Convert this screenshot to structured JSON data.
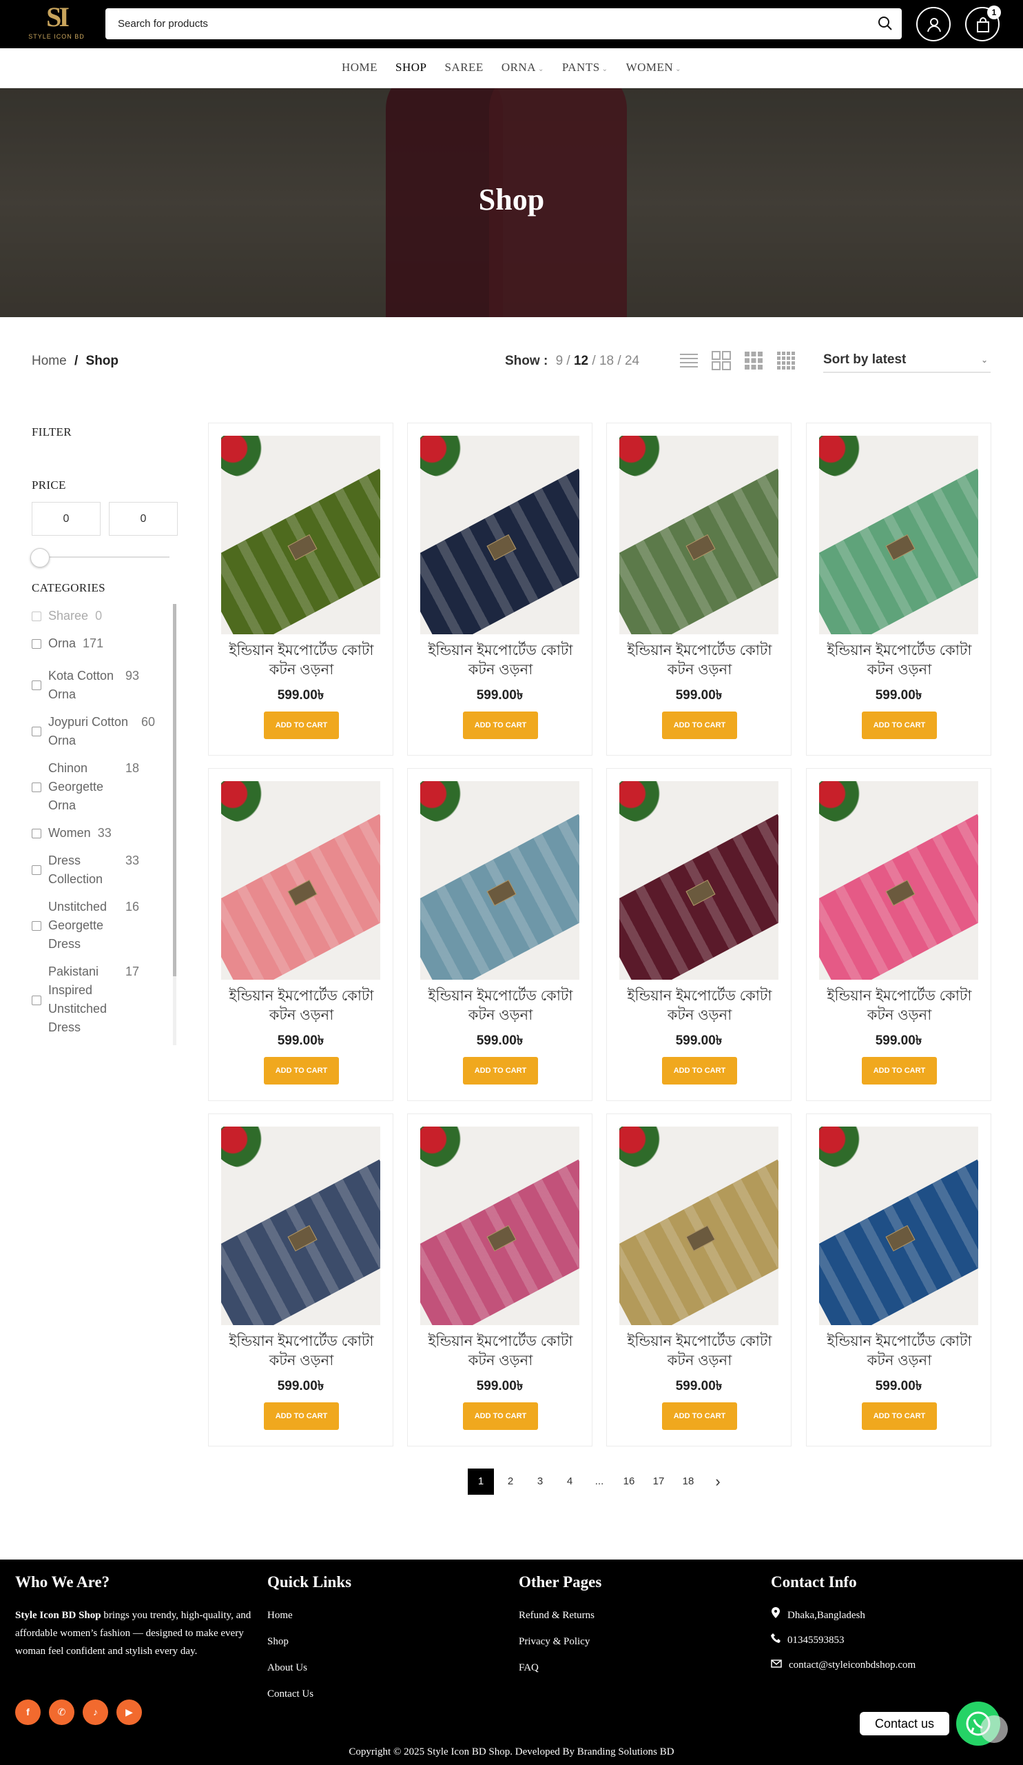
{
  "brand": {
    "mark": "SI",
    "name": "STYLE ICON BD"
  },
  "search": {
    "placeholder": "Search for products"
  },
  "cart": {
    "count": "1"
  },
  "nav": {
    "items": [
      "HOME",
      "SHOP",
      "SAREE",
      "ORNA",
      "PANTS",
      "WOMEN"
    ]
  },
  "hero": {
    "title": "Shop"
  },
  "breadcrumb": {
    "home": "Home",
    "sep": "/",
    "current": "Shop"
  },
  "show": {
    "label": "Show :",
    "options": [
      "9",
      "12",
      "18",
      "24"
    ],
    "selected": "12"
  },
  "sort": {
    "value": "Sort by latest"
  },
  "sidebar": {
    "filter_title": "FILTER",
    "price_title": "PRICE",
    "price_min": "0",
    "price_max": "0",
    "categories_title": "CATEGORIES",
    "categories": [
      {
        "name": "Sharee",
        "count": "0"
      },
      {
        "name": "Orna",
        "count": "171"
      },
      {
        "name": "Kota Cotton Orna",
        "count": "93"
      },
      {
        "name": "Joypuri Cotton Orna",
        "count": "60"
      },
      {
        "name": "Chinon Georgette Orna",
        "count": "18"
      },
      {
        "name": "Women",
        "count": "33"
      },
      {
        "name": "Dress Collection",
        "count": "33"
      },
      {
        "name": "Unstitched Georgette Dress",
        "count": "16"
      },
      {
        "name": "Pakistani Inspired Unstitched Dress",
        "count": "17"
      }
    ]
  },
  "products": [
    {
      "title": "ইন্ডিয়ান ইমপোর্টেড কোটা কটন ওড়না",
      "price": "599.00৳",
      "button": "ADD TO CART",
      "color": "#4e6a1e"
    },
    {
      "title": "ইন্ডিয়ান ইমপোর্টেড কোটা কটন ওড়না",
      "price": "599.00৳",
      "button": "ADD TO CART",
      "color": "#1d2740"
    },
    {
      "title": "ইন্ডিয়ান ইমপোর্টেড কোটা কটন ওড়না",
      "price": "599.00৳",
      "button": "ADD TO CART",
      "color": "#5c7a4a"
    },
    {
      "title": "ইন্ডিয়ান ইমপোর্টেড কোটা কটন ওড়না",
      "price": "599.00৳",
      "button": "ADD TO CART",
      "color": "#5fa37a"
    },
    {
      "title": "ইন্ডিয়ান ইমপোর্টেড কোটা কটন ওড়না",
      "price": "599.00৳",
      "button": "ADD TO CART",
      "color": "#e88a8e"
    },
    {
      "title": "ইন্ডিয়ান ইমপোর্টেড কোটা কটন ওড়না",
      "price": "599.00৳",
      "button": "ADD TO CART",
      "color": "#6e97a8"
    },
    {
      "title": "ইন্ডিয়ান ইমপোর্টেড কোটা কটন ওড়না",
      "price": "599.00৳",
      "button": "ADD TO CART",
      "color": "#5a1a2a"
    },
    {
      "title": "ইন্ডিয়ান ইমপোর্টেড কোটা কটন ওড়না",
      "price": "599.00৳",
      "button": "ADD TO CART",
      "color": "#e55a86"
    },
    {
      "title": "ইন্ডিয়ান ইমপোর্টেড কোটা কটন ওড়না",
      "price": "599.00৳",
      "button": "ADD TO CART",
      "color": "#3c4c6a"
    },
    {
      "title": "ইন্ডিয়ান ইমপোর্টেড কোটা কটন ওড়না",
      "price": "599.00৳",
      "button": "ADD TO CART",
      "color": "#c2527a"
    },
    {
      "title": "ইন্ডিয়ান ইমপোর্টেড কোটা কটন ওড়না",
      "price": "599.00৳",
      "button": "ADD TO CART",
      "color": "#b39a5a"
    },
    {
      "title": "ইন্ডিয়ান ইমপোর্টেড কোটা কটন ওড়না",
      "price": "599.00৳",
      "button": "ADD TO CART",
      "color": "#1f4f86"
    }
  ],
  "pagination": {
    "pages": [
      "1",
      "2",
      "3",
      "4",
      "...",
      "16",
      "17",
      "18"
    ],
    "current": "1",
    "next": "›"
  },
  "footer": {
    "about_title": "Who We Are?",
    "about_brand": "Style Icon BD Shop",
    "about_text": " brings you trendy, high-quality, and affordable women’s fashion — designed to make every woman feel confident and stylish every day.",
    "quick_title": "Quick Links",
    "quick_links": [
      "Home",
      "Shop",
      "About Us",
      "Contact Us"
    ],
    "other_title": "Other Pages",
    "other_links": [
      "Refund & Returns",
      "Privacy & Policy",
      "FAQ"
    ],
    "contact_title": "Contact Info",
    "address": "Dhaka,Bangladesh",
    "phone": "01345593853",
    "email": "contact@styleiconbdshop.com",
    "social": [
      "facebook-icon",
      "whatsapp-icon",
      "tiktok-icon",
      "youtube-icon"
    ],
    "copyright": "Copyright © 2025 Style Icon BD Shop. Developed By Branding Solutions BD"
  },
  "chat": {
    "label": "Contact us"
  },
  "colors": {
    "accent": "#f0a81e",
    "social": "#f26a2e",
    "whatsapp": "#25d366"
  }
}
